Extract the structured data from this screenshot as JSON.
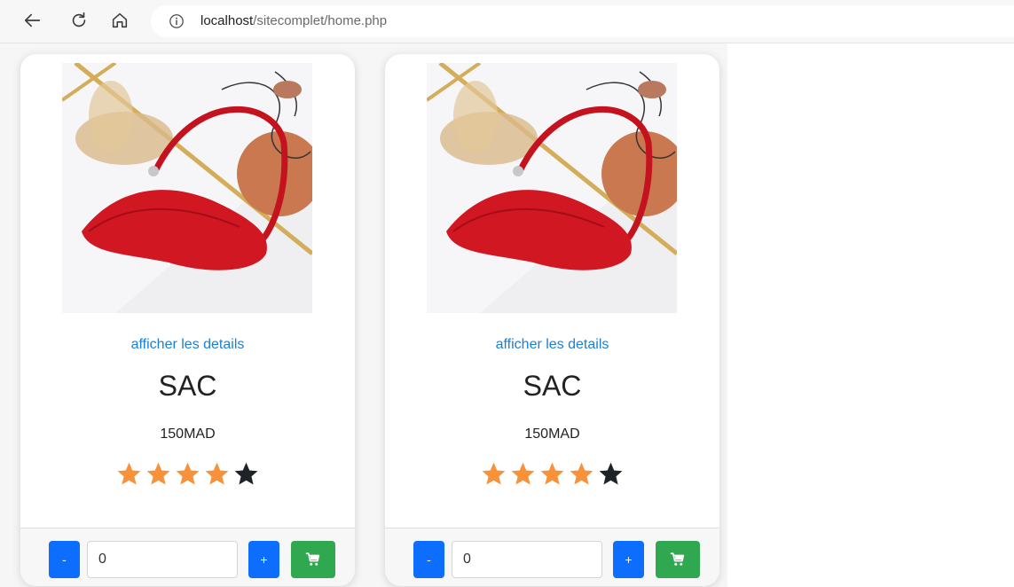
{
  "browser": {
    "url_host": "localhost",
    "url_path": "/sitecomplet/home.php"
  },
  "products": [
    {
      "details_link": "afficher les details",
      "name": "SAC",
      "price": "150MAD",
      "rating": 4,
      "rating_max": 5,
      "quantity": "0",
      "minus_label": "-",
      "plus_label": "+"
    },
    {
      "details_link": "afficher les details",
      "name": "SAC",
      "price": "150MAD",
      "rating": 4,
      "rating_max": 5,
      "quantity": "0",
      "minus_label": "-",
      "plus_label": "+"
    }
  ],
  "colors": {
    "star_filled": "#f7923a",
    "star_empty": "#1f2328",
    "primary": "#0d6efd",
    "cart": "#2fa84f",
    "link": "#1a7fd6"
  },
  "icons": {
    "back": "arrow-left-icon",
    "reload": "reload-icon",
    "home": "home-icon",
    "info": "info-icon",
    "cart": "shopping-cart-icon"
  }
}
